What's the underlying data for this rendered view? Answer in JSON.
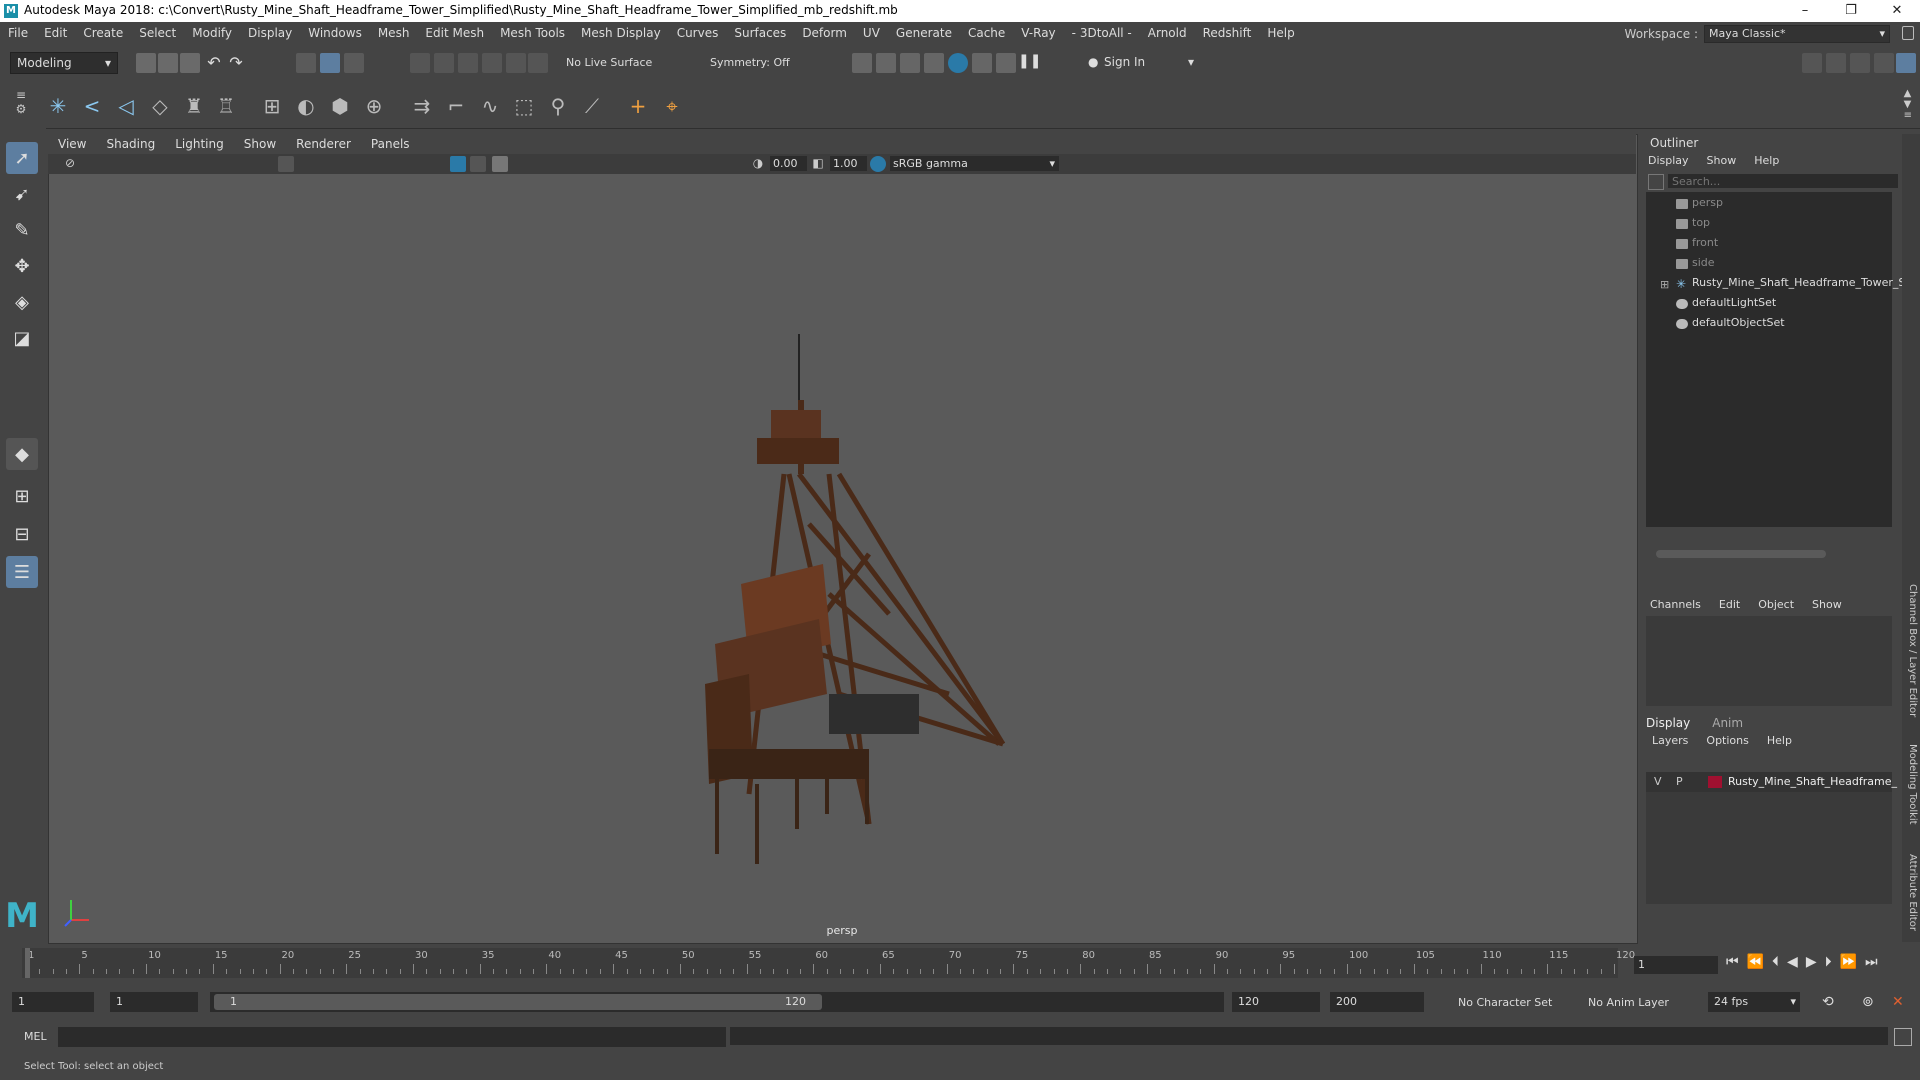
{
  "window": {
    "title": "Autodesk Maya 2018: c:\\Convert\\Rusty_Mine_Shaft_Headframe_Tower_Simplified\\Rusty_Mine_Shaft_Headframe_Tower_Simplified_mb_redshift.mb",
    "minimize": "–",
    "maximize": "❐",
    "close": "✕"
  },
  "menus": [
    "File",
    "Edit",
    "Create",
    "Select",
    "Modify",
    "Display",
    "Windows",
    "Mesh",
    "Edit Mesh",
    "Mesh Tools",
    "Mesh Display",
    "Curves",
    "Surfaces",
    "Deform",
    "UV",
    "Generate",
    "Cache",
    "V-Ray",
    "- 3DtoAll -",
    "Arnold",
    "Redshift",
    "Help"
  ],
  "workspace": {
    "label": "Workspace :",
    "value": "Maya Classic*"
  },
  "status_line": {
    "mode": "Modeling",
    "live_surface": "No Live Surface",
    "symmetry": "Symmetry: Off",
    "sign_in": "Sign In"
  },
  "panel": {
    "menus": [
      "View",
      "Shading",
      "Lighting",
      "Show",
      "Renderer",
      "Panels"
    ],
    "exposure": "0.00",
    "gamma": "1.00",
    "color_space": "sRGB gamma",
    "camera": "persp"
  },
  "outliner": {
    "title": "Outliner",
    "menus": [
      "Display",
      "Show",
      "Help"
    ],
    "search_placeholder": "Search...",
    "items": [
      {
        "label": "persp",
        "dim": true
      },
      {
        "label": "top",
        "dim": true
      },
      {
        "label": "front",
        "dim": true
      },
      {
        "label": "side",
        "dim": true
      },
      {
        "label": "Rusty_Mine_Shaft_Headframe_Tower_Sir",
        "dim": false
      },
      {
        "label": "defaultLightSet",
        "dim": false
      },
      {
        "label": "defaultObjectSet",
        "dim": false
      }
    ]
  },
  "channel_box": {
    "menus": [
      "Channels",
      "Edit",
      "Object",
      "Show"
    ]
  },
  "layer_editor": {
    "tabs": [
      "Display",
      "Anim"
    ],
    "menus": [
      "Layers",
      "Options",
      "Help"
    ],
    "layer": {
      "v": "V",
      "p": "P",
      "name": "Rusty_Mine_Shaft_Headframe_",
      "color": "#a01030"
    }
  },
  "side_tabs": [
    "Channel Box / Layer Editor",
    "Modeling Toolkit",
    "Attribute Editor"
  ],
  "timeline": {
    "ticks": [
      "1",
      "5",
      "10",
      "15",
      "20",
      "25",
      "30",
      "35",
      "40",
      "45",
      "50",
      "55",
      "60",
      "65",
      "70",
      "75",
      "80",
      "85",
      "90",
      "95",
      "100",
      "105",
      "110",
      "115",
      "120"
    ],
    "current_frame": "1"
  },
  "range": {
    "start": "1",
    "anim_start": "1",
    "slider_start": "1",
    "slider_end": "120",
    "end": "120",
    "anim_end": "200",
    "character_set": "No Character Set",
    "anim_layer": "No Anim Layer",
    "fps": "24 fps"
  },
  "command_line": {
    "label": "MEL"
  },
  "help_line": {
    "text": "Select Tool: select an object"
  }
}
